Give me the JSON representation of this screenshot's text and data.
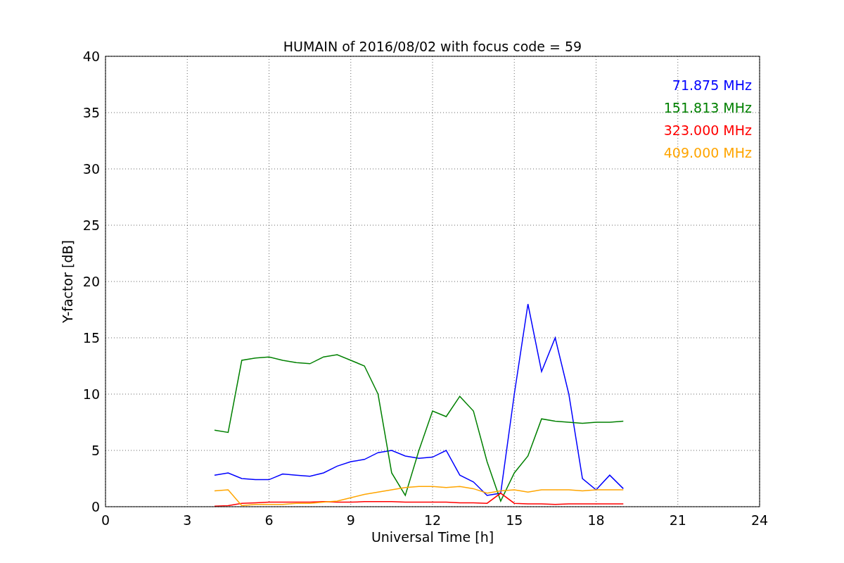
{
  "chart_data": {
    "type": "line",
    "title": "HUMAIN of 2016/08/02 with focus code = 59",
    "xlabel": "Universal Time [h]",
    "ylabel": "Y-factor [dB]",
    "x": [
      4,
      4.5,
      5,
      5.5,
      6,
      6.5,
      7,
      7.5,
      8,
      8.5,
      9,
      9.5,
      10,
      10.5,
      11,
      11.5,
      12,
      12.5,
      13,
      13.5,
      14,
      14.5,
      15,
      15.5,
      16,
      16.5,
      17,
      17.5,
      18,
      18.5,
      19
    ],
    "series": [
      {
        "name": "71.875 MHz",
        "color": "#0000ff",
        "values": [
          2.8,
          3.0,
          2.5,
          2.4,
          2.4,
          2.9,
          2.8,
          2.7,
          3.0,
          3.6,
          4.0,
          4.2,
          4.8,
          5.0,
          4.5,
          4.3,
          4.4,
          5.0,
          2.8,
          2.2,
          1.0,
          1.2,
          10,
          18,
          12,
          15,
          10,
          2.5,
          1.5,
          2.8,
          1.6
        ]
      },
      {
        "name": "151.813 MHz",
        "color": "#008000",
        "values": [
          6.8,
          6.6,
          13,
          13.2,
          13.3,
          13,
          12.8,
          12.7,
          13.3,
          13.5,
          13,
          12.5,
          10,
          3,
          1,
          5,
          8.5,
          8,
          9.8,
          8.5,
          4,
          0.5,
          3,
          4.5,
          7.8,
          7.6,
          7.5,
          7.4,
          7.5,
          7.5,
          7.6
        ]
      },
      {
        "name": "323.000 MHz",
        "color": "#ff0000",
        "values": [
          0.05,
          0.1,
          0.3,
          0.35,
          0.4,
          0.4,
          0.4,
          0.4,
          0.45,
          0.4,
          0.4,
          0.45,
          0.45,
          0.45,
          0.4,
          0.4,
          0.4,
          0.4,
          0.35,
          0.35,
          0.3,
          1.2,
          0.3,
          0.25,
          0.25,
          0.2,
          0.25,
          0.25,
          0.25,
          0.25,
          0.25
        ]
      },
      {
        "name": "409.000 MHz",
        "color": "#ffa500",
        "values": [
          1.4,
          1.5,
          0.1,
          0.2,
          0.2,
          0.2,
          0.3,
          0.3,
          0.4,
          0.5,
          0.8,
          1.1,
          1.3,
          1.5,
          1.7,
          1.8,
          1.8,
          1.7,
          1.8,
          1.6,
          1.2,
          1.4,
          1.5,
          1.3,
          1.5,
          1.5,
          1.5,
          1.4,
          1.5,
          1.5,
          1.5
        ]
      }
    ],
    "grid": true,
    "xlim": [
      0,
      24
    ],
    "ylim": [
      0,
      40
    ],
    "xticks": [
      0,
      3,
      6,
      9,
      12,
      15,
      18,
      21,
      24
    ],
    "yticks": [
      0,
      5,
      10,
      15,
      20,
      25,
      30,
      35,
      40
    ]
  }
}
